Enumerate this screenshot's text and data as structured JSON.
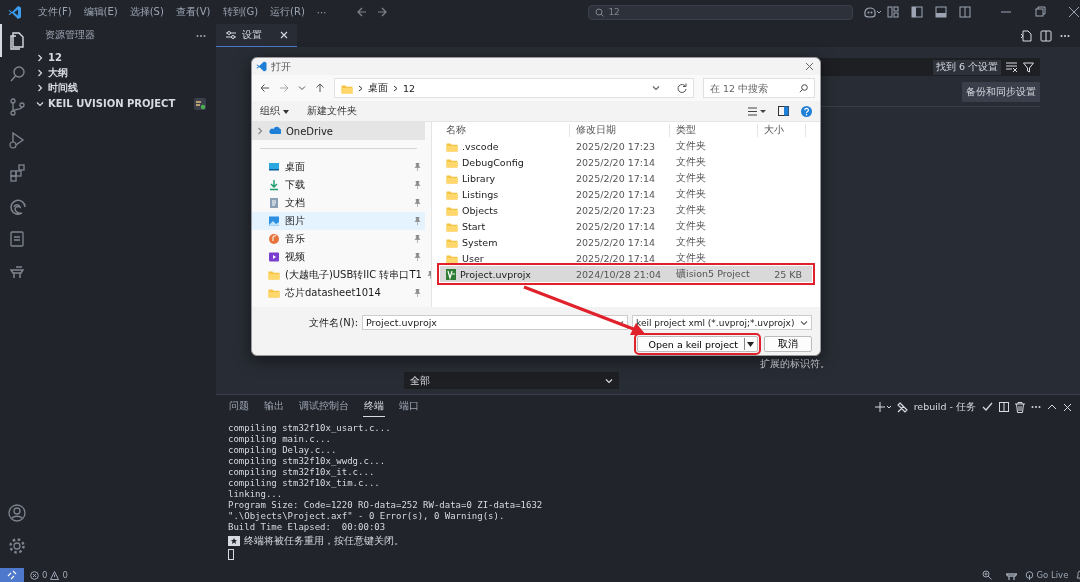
{
  "menu_bar": {
    "items": [
      "文件(F)",
      "编辑(E)",
      "选择(S)",
      "查看(V)",
      "转到(G)",
      "运行(R)",
      "···"
    ],
    "search": {
      "value": "12"
    }
  },
  "activity_bar": [
    {
      "kind": "files",
      "selected": true
    },
    {
      "kind": "search",
      "selected": false
    },
    {
      "kind": "source-control",
      "selected": false
    },
    {
      "kind": "run",
      "selected": false
    },
    {
      "kind": "extensions",
      "selected": false
    },
    {
      "kind": "edge",
      "selected": false
    },
    {
      "kind": "remote",
      "selected": false
    },
    {
      "kind": "keil",
      "selected": false
    }
  ],
  "sidebar": {
    "title": "资源管理器",
    "sections": [
      {
        "label": "12",
        "expanded": false
      },
      {
        "label": "大纲",
        "expanded": false
      },
      {
        "label": "时间线",
        "expanded": false
      },
      {
        "label": "KEIL UVISION PROJECT",
        "expanded": true
      }
    ]
  },
  "editor": {
    "tabs": [
      {
        "label": "设置",
        "selected": true
      }
    ],
    "settings": {
      "result_count": "找到 6 个设置",
      "sync_button": "备份和同步设置",
      "description": "扩展的标识符。",
      "dropdown": "全部"
    }
  },
  "dialog": {
    "title": "打开",
    "path": [
      "桌面",
      "12"
    ],
    "search_placeholder": "在 12 中搜索",
    "toolbar": [
      "组织",
      "新建文件夹"
    ],
    "nav": [
      {
        "label": "OneDrive",
        "kind": "cloud",
        "selected": true,
        "hovered": false
      },
      {
        "label": "桌面",
        "kind": "desktop",
        "selected": false,
        "hovered": false
      },
      {
        "label": "下载",
        "kind": "download",
        "selected": false,
        "hovered": false
      },
      {
        "label": "文档",
        "kind": "document",
        "selected": false,
        "hovered": false
      },
      {
        "label": "图片",
        "kind": "picture",
        "selected": false,
        "hovered": true
      },
      {
        "label": "音乐",
        "kind": "music",
        "selected": false,
        "hovered": false
      },
      {
        "label": "视频",
        "kind": "video",
        "selected": false,
        "hovered": false
      },
      {
        "label": "(大越电子)USB转IIC 转串口T1",
        "kind": "folder",
        "selected": false,
        "hovered": false
      },
      {
        "label": "芯片datasheet1014",
        "kind": "folder",
        "selected": false,
        "hovered": false
      }
    ],
    "columns": [
      "名称",
      "修改日期",
      "类型",
      "大小"
    ],
    "rows": [
      {
        "name": ".vscode",
        "date": "2025/2/20 17:23",
        "type": "文件夹",
        "kind": "folder",
        "selected": false,
        "highlighted": false
      },
      {
        "name": "DebugConfig",
        "date": "2025/2/20 17:14",
        "type": "文件夹",
        "kind": "folder",
        "selected": false,
        "highlighted": false
      },
      {
        "name": "Library",
        "date": "2025/2/20 17:14",
        "type": "文件夹",
        "kind": "folder",
        "selected": false,
        "highlighted": false
      },
      {
        "name": "Listings",
        "date": "2025/2/20 17:14",
        "type": "文件夹",
        "kind": "folder",
        "selected": false,
        "highlighted": false
      },
      {
        "name": "Objects",
        "date": "2025/2/20 17:23",
        "type": "文件夹",
        "kind": "folder",
        "selected": false,
        "highlighted": false
      },
      {
        "name": "Start",
        "date": "2025/2/20 17:14",
        "type": "文件夹",
        "kind": "folder",
        "selected": false,
        "highlighted": false
      },
      {
        "name": "System",
        "date": "2025/2/20 17:14",
        "type": "文件夹",
        "kind": "folder",
        "selected": false,
        "highlighted": false
      },
      {
        "name": "User",
        "date": "2025/2/20 17:14",
        "type": "文件夹",
        "kind": "folder",
        "selected": false,
        "highlighted": false
      },
      {
        "name": "Project.uvprojx",
        "date": "2024/10/28 21:04",
        "type": "礦ision5 Project",
        "size": "25 KB",
        "kind": "project",
        "selected": true,
        "highlighted": true
      }
    ],
    "file_name_label": "文件名(N):",
    "file_name": "Project.uvprojx",
    "filter": "keil project xml (*.uvproj;*.uvprojx)",
    "buttons": [
      {
        "label": "Open a keil project",
        "kind": "split",
        "highlighted": true
      },
      {
        "label": "取消",
        "kind": "plain",
        "highlighted": false
      }
    ]
  },
  "panel": {
    "tabs": [
      {
        "label": "问题",
        "selected": false
      },
      {
        "label": "输出",
        "selected": false
      },
      {
        "label": "调试控制台",
        "selected": false
      },
      {
        "label": "终端",
        "selected": true
      },
      {
        "label": "端口",
        "selected": false
      }
    ],
    "task": "rebuild - 任务",
    "terminal_lines": [
      "compiling stm32f10x_usart.c...",
      "compiling main.c...",
      "compiling Delay.c...",
      "compiling stm32f10x_wwdg.c...",
      "compiling stm32f10x_it.c...",
      "compiling stm32f10x_tim.c...",
      "linking...",
      "Program Size: Code=1220 RO-data=252 RW-data=0 ZI-data=1632",
      "\".\\Objects\\Project.axf\" - 0 Error(s), 0 Warning(s).",
      "Build Time Elapsed:  00:00:03"
    ],
    "notice": "终端将被任务重用，按任意键关闭。"
  },
  "status_bar": {
    "errors": "0",
    "warnings": "0",
    "go_live": "Go Live"
  }
}
